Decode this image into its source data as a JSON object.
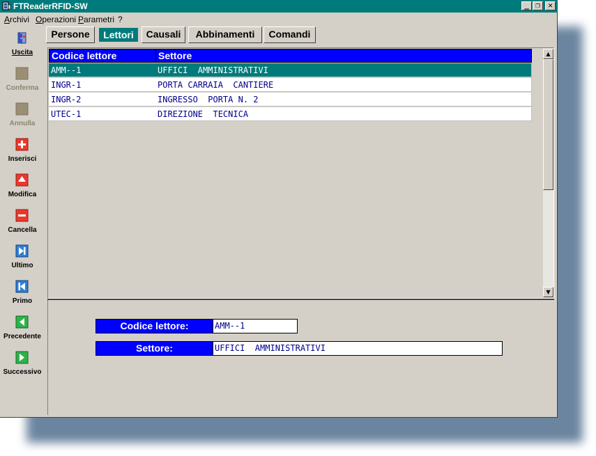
{
  "window": {
    "title": "FTReaderRFID-SW"
  },
  "menu": [
    "Archivi",
    "Operazioni",
    "Parametri",
    "?"
  ],
  "tabs": [
    "Persone",
    "Lettori",
    "Causali",
    "Abbinamenti",
    "Comandi"
  ],
  "active_tab": "Lettori",
  "sidebar": [
    {
      "label": "Uscita",
      "icon": "door-exit-icon",
      "enabled": true
    },
    {
      "label": "Conferma",
      "icon": "confirm-icon",
      "enabled": false
    },
    {
      "label": "Annulla",
      "icon": "cancel-icon",
      "enabled": false
    },
    {
      "label": "Inserisci",
      "icon": "plus-icon",
      "enabled": true
    },
    {
      "label": "Modifica",
      "icon": "arrow-up-icon",
      "enabled": true
    },
    {
      "label": "Cancella",
      "icon": "minus-icon",
      "enabled": true
    },
    {
      "label": "Ultimo",
      "icon": "last-record-icon",
      "enabled": true
    },
    {
      "label": "Primo",
      "icon": "first-record-icon",
      "enabled": true
    },
    {
      "label": "Precedente",
      "icon": "previous-record-icon",
      "enabled": true
    },
    {
      "label": "Successivo",
      "icon": "next-record-icon",
      "enabled": true
    }
  ],
  "table": {
    "columns": [
      "Codice lettore",
      "Settore"
    ],
    "rows": [
      [
        "AMM--1",
        "UFFICI  AMMINISTRATIVI"
      ],
      [
        "INGR-1",
        "PORTA CARRAIA  CANTIERE"
      ],
      [
        "INGR-2",
        "INGRESSO  PORTA N. 2"
      ],
      [
        "UTEC-1",
        "DIREZIONE  TECNICA"
      ]
    ],
    "selected_row": 0
  },
  "detail": {
    "codice_label": "Codice lettore:",
    "codice_value": "AMM--1",
    "settore_label": "Settore:",
    "settore_value": "UFFICI  AMMINISTRATIVI"
  },
  "colors": {
    "titlebar": "#007b7b",
    "header": "#0000ff",
    "selection": "#007b7b",
    "face": "#d4d0c8",
    "text_blue": "#00008b"
  }
}
